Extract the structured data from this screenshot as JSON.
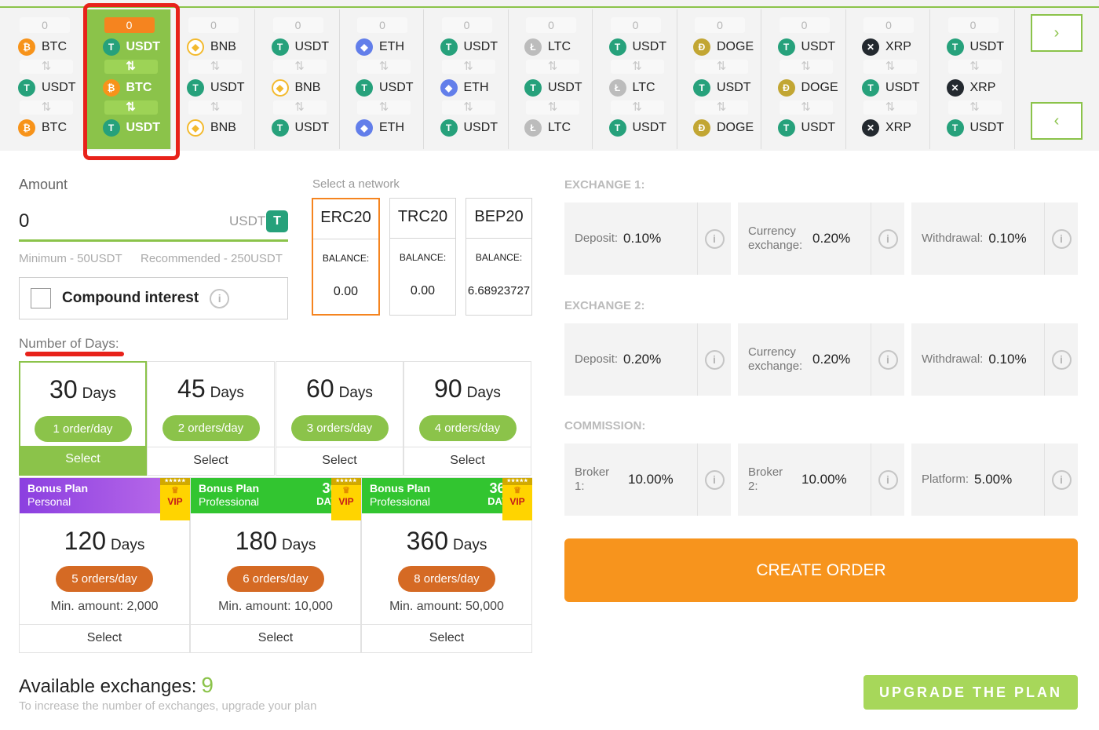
{
  "pairs": [
    {
      "count": "0",
      "top": "BTC",
      "mid": "USDT",
      "bottom": "BTC",
      "top_icon": "btc",
      "mid_icon": "usdt",
      "bottom_icon": "btc"
    },
    {
      "count": "0",
      "top": "USDT",
      "mid": "BTC",
      "bottom": "USDT",
      "top_icon": "usdt",
      "mid_icon": "btc",
      "bottom_icon": "usdt",
      "active": true
    },
    {
      "count": "0",
      "top": "BNB",
      "mid": "USDT",
      "bottom": "BNB",
      "top_icon": "bnb",
      "mid_icon": "usdt",
      "bottom_icon": "bnb"
    },
    {
      "count": "0",
      "top": "USDT",
      "mid": "BNB",
      "bottom": "USDT",
      "top_icon": "usdt",
      "mid_icon": "bnb",
      "bottom_icon": "usdt"
    },
    {
      "count": "0",
      "top": "ETH",
      "mid": "USDT",
      "bottom": "ETH",
      "top_icon": "eth",
      "mid_icon": "usdt",
      "bottom_icon": "eth"
    },
    {
      "count": "0",
      "top": "USDT",
      "mid": "ETH",
      "bottom": "USDT",
      "top_icon": "usdt",
      "mid_icon": "eth",
      "bottom_icon": "usdt"
    },
    {
      "count": "0",
      "top": "LTC",
      "mid": "USDT",
      "bottom": "LTC",
      "top_icon": "ltc",
      "mid_icon": "usdt",
      "bottom_icon": "ltc"
    },
    {
      "count": "0",
      "top": "USDT",
      "mid": "LTC",
      "bottom": "USDT",
      "top_icon": "usdt",
      "mid_icon": "ltc",
      "bottom_icon": "usdt"
    },
    {
      "count": "0",
      "top": "DOGE",
      "mid": "USDT",
      "bottom": "DOGE",
      "top_icon": "doge",
      "mid_icon": "usdt",
      "bottom_icon": "doge"
    },
    {
      "count": "0",
      "top": "USDT",
      "mid": "DOGE",
      "bottom": "USDT",
      "top_icon": "usdt",
      "mid_icon": "doge",
      "bottom_icon": "usdt"
    },
    {
      "count": "0",
      "top": "XRP",
      "mid": "USDT",
      "bottom": "XRP",
      "top_icon": "xrp",
      "mid_icon": "usdt",
      "bottom_icon": "xrp"
    },
    {
      "count": "0",
      "top": "USDT",
      "mid": "XRP",
      "bottom": "USDT",
      "top_icon": "usdt",
      "mid_icon": "xrp",
      "bottom_icon": "usdt"
    }
  ],
  "icons": {
    "next": "chevron-right-icon",
    "prev": "chevron-left-icon",
    "swap": "swap-arrows-icon",
    "info": "info-icon"
  },
  "glyphs": {
    "next": "›",
    "prev": "‹",
    "swap": "⇅",
    "info": "i",
    "usdt": "T",
    "btc": "₿",
    "bnb": "◆",
    "eth": "◆",
    "ltc": "Ł",
    "doge": "Ð",
    "xrp": "✕"
  },
  "amount": {
    "label": "Amount",
    "value": "0",
    "currency": "USDT",
    "minimum": "Minimum - 50USDT",
    "recommended": "Recommended - 250USDT",
    "compound_label": "Compound interest"
  },
  "network": {
    "label": "Select a network",
    "options": [
      {
        "name": "ERC20",
        "balance_label": "BALANCE:",
        "balance": "0.00",
        "selected": true
      },
      {
        "name": "TRC20",
        "balance_label": "BALANCE:",
        "balance": "0.00"
      },
      {
        "name": "BEP20",
        "balance_label": "BALANCE:",
        "balance": "6.68923727"
      }
    ]
  },
  "days": {
    "label": "Number of Days:",
    "plans": [
      {
        "days": "30",
        "unit": "Days",
        "orders": "1 order/day",
        "select": "Select",
        "selected": true
      },
      {
        "days": "45",
        "unit": "Days",
        "orders": "2 orders/day",
        "select": "Select"
      },
      {
        "days": "60",
        "unit": "Days",
        "orders": "3 orders/day",
        "select": "Select"
      },
      {
        "days": "90",
        "unit": "Days",
        "orders": "4 orders/day",
        "select": "Select"
      }
    ],
    "bonus_plans": [
      {
        "title": "Bonus Plan",
        "subtitle": "Personal",
        "badge_days": "",
        "badge_unit": "",
        "vip": "VIP",
        "days": "120",
        "unit": "Days",
        "orders": "5 orders/day",
        "min_amount": "Min. amount: 2,000",
        "select": "Select",
        "color": "#8b3fe0"
      },
      {
        "title": "Bonus Plan",
        "subtitle": "Professional",
        "badge_days": "30",
        "badge_unit": "DAYS",
        "vip": "VIP",
        "days": "180",
        "unit": "Days",
        "orders": "6 orders/day",
        "min_amount": "Min. amount: 10,000",
        "select": "Select",
        "color": "#32c530"
      },
      {
        "title": "Bonus Plan",
        "subtitle": "Professional",
        "badge_days": "360",
        "badge_unit": "DAYS",
        "vip": "VIP",
        "days": "360",
        "unit": "Days",
        "orders": "8 orders/day",
        "min_amount": "Min. amount: 50,000",
        "select": "Select",
        "color": "#32c530"
      }
    ]
  },
  "exchange1": {
    "label": "EXCHANGE 1:",
    "fees": [
      {
        "label": "Deposit:",
        "value": "0.10%"
      },
      {
        "label": "Currency exchange:",
        "value": "0.20%"
      },
      {
        "label": "Withdrawal:",
        "value": "0.10%"
      }
    ]
  },
  "exchange2": {
    "label": "EXCHANGE 2:",
    "fees": [
      {
        "label": "Deposit:",
        "value": "0.20%"
      },
      {
        "label": "Currency exchange:",
        "value": "0.20%"
      },
      {
        "label": "Withdrawal:",
        "value": "0.10%"
      }
    ]
  },
  "commission": {
    "label": "COMMISSION:",
    "fees": [
      {
        "label": "Broker 1:",
        "value": "10.00%"
      },
      {
        "label": "Broker 2:",
        "value": "10.00%"
      },
      {
        "label": "Platform:",
        "value": "5.00%"
      }
    ]
  },
  "create_order": "CREATE ORDER",
  "available": {
    "label": "Available exchanges:",
    "count": "9",
    "hint": "To increase the number of exchanges, upgrade your plan"
  },
  "upgrade": "UPGRADE THE PLAN",
  "colors": {
    "accent": "#8bc34a",
    "orange": "#f7941d",
    "annotation": "#e8221a"
  }
}
